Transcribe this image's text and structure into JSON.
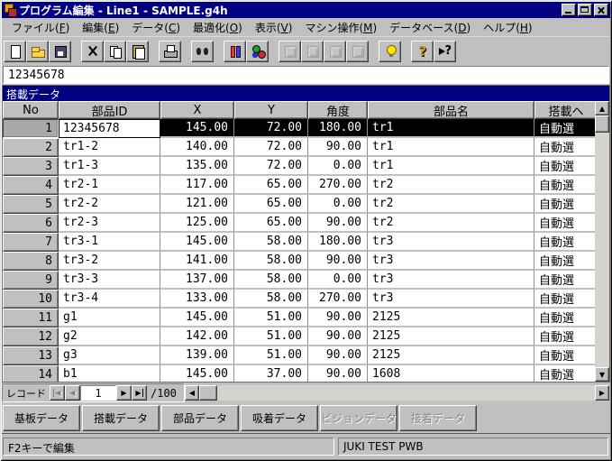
{
  "window": {
    "title": "プログラム編集 - Line1 - SAMPLE.g4h"
  },
  "colors": {
    "titlebar": "#000080",
    "chrome": "#c0c0c0",
    "selection_bg": "#000000",
    "selection_fg": "#ffffff"
  },
  "menu": {
    "items": [
      {
        "id": "file",
        "label": "ファイル(F)"
      },
      {
        "id": "edit",
        "label": "編集(E)"
      },
      {
        "id": "data",
        "label": "データ(C)"
      },
      {
        "id": "optimize",
        "label": "最適化(O)"
      },
      {
        "id": "view",
        "label": "表示(V)"
      },
      {
        "id": "machine",
        "label": "マシン操作(M)"
      },
      {
        "id": "database",
        "label": "データベース(D)"
      },
      {
        "id": "help",
        "label": "ヘルプ(H)"
      }
    ]
  },
  "toolbar": {
    "buttons": [
      {
        "id": "new-file",
        "icon": "new",
        "disabled": false,
        "gap": false
      },
      {
        "id": "open-file",
        "icon": "open",
        "disabled": false,
        "gap": false
      },
      {
        "id": "save-file",
        "icon": "save",
        "disabled": false,
        "gap": false
      },
      {
        "id": "cut",
        "icon": "cut",
        "disabled": false,
        "gap": true
      },
      {
        "id": "copy",
        "icon": "copy",
        "disabled": false,
        "gap": false
      },
      {
        "id": "paste",
        "icon": "paste",
        "disabled": false,
        "gap": false
      },
      {
        "id": "print",
        "icon": "print",
        "disabled": false,
        "gap": true
      },
      {
        "id": "find",
        "icon": "find",
        "disabled": false,
        "gap": true
      },
      {
        "id": "machine-tools",
        "icon": "pins",
        "disabled": false,
        "gap": true
      },
      {
        "id": "part-colors",
        "icon": "balls",
        "disabled": false,
        "gap": false
      },
      {
        "id": "pcb-view",
        "icon": "pcb",
        "disabled": true,
        "gap": true
      },
      {
        "id": "feeder-view",
        "icon": "feeder",
        "disabled": true,
        "gap": false
      },
      {
        "id": "package-view",
        "icon": "package",
        "disabled": true,
        "gap": false
      },
      {
        "id": "nozzle-view",
        "icon": "nozzle",
        "disabled": true,
        "gap": false
      },
      {
        "id": "tip",
        "icon": "bulb",
        "disabled": false,
        "gap": true
      },
      {
        "id": "help",
        "icon": "help",
        "disabled": false,
        "gap": true
      },
      {
        "id": "context-help",
        "icon": "context-help",
        "disabled": false,
        "gap": false
      }
    ]
  },
  "edit_bar": {
    "value": "12345678"
  },
  "document": {
    "caption": "搭載データ"
  },
  "table": {
    "columns": [
      {
        "id": "no",
        "label": "No"
      },
      {
        "id": "part_id",
        "label": "部品ID"
      },
      {
        "id": "x",
        "label": "X"
      },
      {
        "id": "y",
        "label": "Y"
      },
      {
        "id": "angle",
        "label": "角度"
      },
      {
        "id": "part_name",
        "label": "部品名"
      },
      {
        "id": "head",
        "label": "搭載ヘ"
      }
    ],
    "selected_row": "1",
    "editing": {
      "row": "1",
      "column": "part_id"
    },
    "rows": [
      {
        "no": "1",
        "part_id": "12345678",
        "x": "145.00",
        "y": "72.00",
        "angle": "180.00",
        "part_name": "tr1",
        "head": "自動選"
      },
      {
        "no": "2",
        "part_id": "tr1-2",
        "x": "140.00",
        "y": "72.00",
        "angle": "90.00",
        "part_name": "tr1",
        "head": "自動選"
      },
      {
        "no": "3",
        "part_id": "tr1-3",
        "x": "135.00",
        "y": "72.00",
        "angle": "0.00",
        "part_name": "tr1",
        "head": "自動選"
      },
      {
        "no": "4",
        "part_id": "tr2-1",
        "x": "117.00",
        "y": "65.00",
        "angle": "270.00",
        "part_name": "tr2",
        "head": "自動選"
      },
      {
        "no": "5",
        "part_id": "tr2-2",
        "x": "121.00",
        "y": "65.00",
        "angle": "0.00",
        "part_name": "tr2",
        "head": "自動選"
      },
      {
        "no": "6",
        "part_id": "tr2-3",
        "x": "125.00",
        "y": "65.00",
        "angle": "90.00",
        "part_name": "tr2",
        "head": "自動選"
      },
      {
        "no": "7",
        "part_id": "tr3-1",
        "x": "145.00",
        "y": "58.00",
        "angle": "180.00",
        "part_name": "tr3",
        "head": "自動選"
      },
      {
        "no": "8",
        "part_id": "tr3-2",
        "x": "141.00",
        "y": "58.00",
        "angle": "90.00",
        "part_name": "tr3",
        "head": "自動選"
      },
      {
        "no": "9",
        "part_id": "tr3-3",
        "x": "137.00",
        "y": "58.00",
        "angle": "0.00",
        "part_name": "tr3",
        "head": "自動選"
      },
      {
        "no": "10",
        "part_id": "tr3-4",
        "x": "133.00",
        "y": "58.00",
        "angle": "270.00",
        "part_name": "tr3",
        "head": "自動選"
      },
      {
        "no": "11",
        "part_id": "g1",
        "x": "145.00",
        "y": "51.00",
        "angle": "90.00",
        "part_name": "2125",
        "head": "自動選"
      },
      {
        "no": "12",
        "part_id": "g2",
        "x": "142.00",
        "y": "51.00",
        "angle": "90.00",
        "part_name": "2125",
        "head": "自動選"
      },
      {
        "no": "13",
        "part_id": "g3",
        "x": "139.00",
        "y": "51.00",
        "angle": "90.00",
        "part_name": "2125",
        "head": "自動選"
      },
      {
        "no": "14",
        "part_id": "b1",
        "x": "145.00",
        "y": "37.00",
        "angle": "90.00",
        "part_name": "1608",
        "head": "自動選"
      }
    ]
  },
  "record_nav": {
    "label": "レコード",
    "current": "1",
    "total": "/100"
  },
  "tabs": {
    "items": [
      {
        "id": "board-data",
        "label": "基板データ",
        "enabled": true
      },
      {
        "id": "mount-data",
        "label": "搭載データ",
        "enabled": true
      },
      {
        "id": "part-data",
        "label": "部品データ",
        "enabled": true
      },
      {
        "id": "pickup-data",
        "label": "吸着データ",
        "enabled": true
      },
      {
        "id": "vision-data",
        "label": "ビジョンデータ",
        "enabled": false
      },
      {
        "id": "bond-data",
        "label": "接着データ",
        "enabled": false
      }
    ]
  },
  "status_bar": {
    "left": "F2キーで編集",
    "right": "JUKI TEST PWB"
  }
}
